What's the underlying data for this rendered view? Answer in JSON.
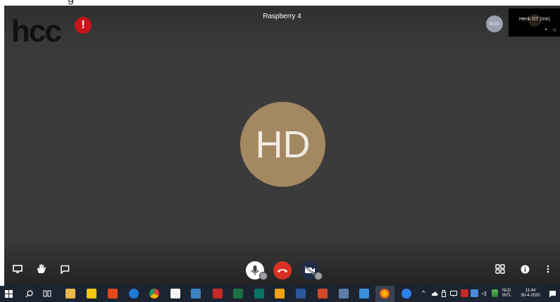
{
  "top_strip": {
    "partial_text": "g"
  },
  "meeting": {
    "title": "Raspberry 4",
    "logo_text": "hcc",
    "logo_badge": "!",
    "participant_initials": "HD",
    "audio_participant": "AUD",
    "self_view_name": "Henk DT (me)"
  },
  "colors": {
    "stage_bg": "#3b3b3b",
    "avatar_bg": "#a48862",
    "hangup_red": "#d93025",
    "badge_red": "#c4161c",
    "taskbar_bg": "#1d2431"
  },
  "controls": {
    "left": [
      {
        "name": "present-screen-icon"
      },
      {
        "name": "raise-hand-icon"
      },
      {
        "name": "chat-icon"
      }
    ],
    "center": [
      {
        "name": "microphone-icon"
      },
      {
        "name": "hang-up-icon"
      },
      {
        "name": "camera-off-icon"
      }
    ],
    "right": [
      {
        "name": "grid-layout-icon"
      },
      {
        "name": "info-icon"
      },
      {
        "name": "more-options-icon"
      }
    ]
  },
  "taskbar": {
    "language_top": "NLD",
    "language_bottom": "INTL",
    "time": "11:44",
    "date": "30-4-2020",
    "pinned_icons": [
      "search-icon",
      "task-view-icon",
      "file-explorer-icon",
      "sticky-icon",
      "office-icon",
      "edge-icon",
      "chrome-icon",
      "store-icon",
      "app-icon",
      "pdf-icon",
      "excel-icon",
      "publisher-icon",
      "outlook-icon",
      "word-icon",
      "powerpoint-icon",
      "media-icon",
      "notes-icon",
      "firefox-icon",
      "browser-icon"
    ]
  }
}
